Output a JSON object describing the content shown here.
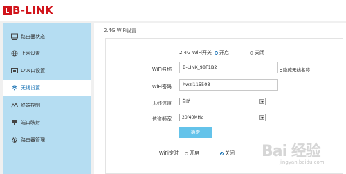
{
  "brand": {
    "logo_text": "B-LINK"
  },
  "sidebar": {
    "items": [
      {
        "label": "路由器状态",
        "icon": "monitor-icon"
      },
      {
        "label": "上网设置",
        "icon": "globe-icon"
      },
      {
        "label": "LAN口设置",
        "icon": "lan-icon"
      },
      {
        "label": "无线设置",
        "icon": "wifi-icon"
      },
      {
        "label": "终端控制",
        "icon": "chart-icon"
      },
      {
        "label": "端口映射",
        "icon": "port-icon"
      },
      {
        "label": "路由器管理",
        "icon": "gear-icon"
      }
    ],
    "active_index": 3
  },
  "main": {
    "section_title": "2.4G WiFi设置",
    "wifi_switch": {
      "label": "2.4G WiFi开关",
      "on_label": "开启",
      "off_label": "关闭",
      "selected": "on"
    },
    "ssid": {
      "label": "WiFi名称",
      "value": "B-LINK_98F1B2",
      "hide_label": "隐藏无线名称"
    },
    "password": {
      "label": "WiFi密码",
      "value": "hwzl115508"
    },
    "channel": {
      "label": "无线信道",
      "value": "自动"
    },
    "bandwidth": {
      "label": "信道频宽",
      "value": "20/40MHz"
    },
    "save_label": "确定",
    "timer": {
      "label": "WiFi定时",
      "on_label": "开启",
      "off_label": "关闭",
      "selected": "off"
    }
  },
  "watermark": {
    "text": "Bai 经验",
    "sub": "jingyan.baidu.com"
  },
  "colors": {
    "brand": "#d1141b",
    "accent": "#64c3ea",
    "sidebar_bg": "#b5ddf2",
    "active_text": "#1a73b5"
  }
}
